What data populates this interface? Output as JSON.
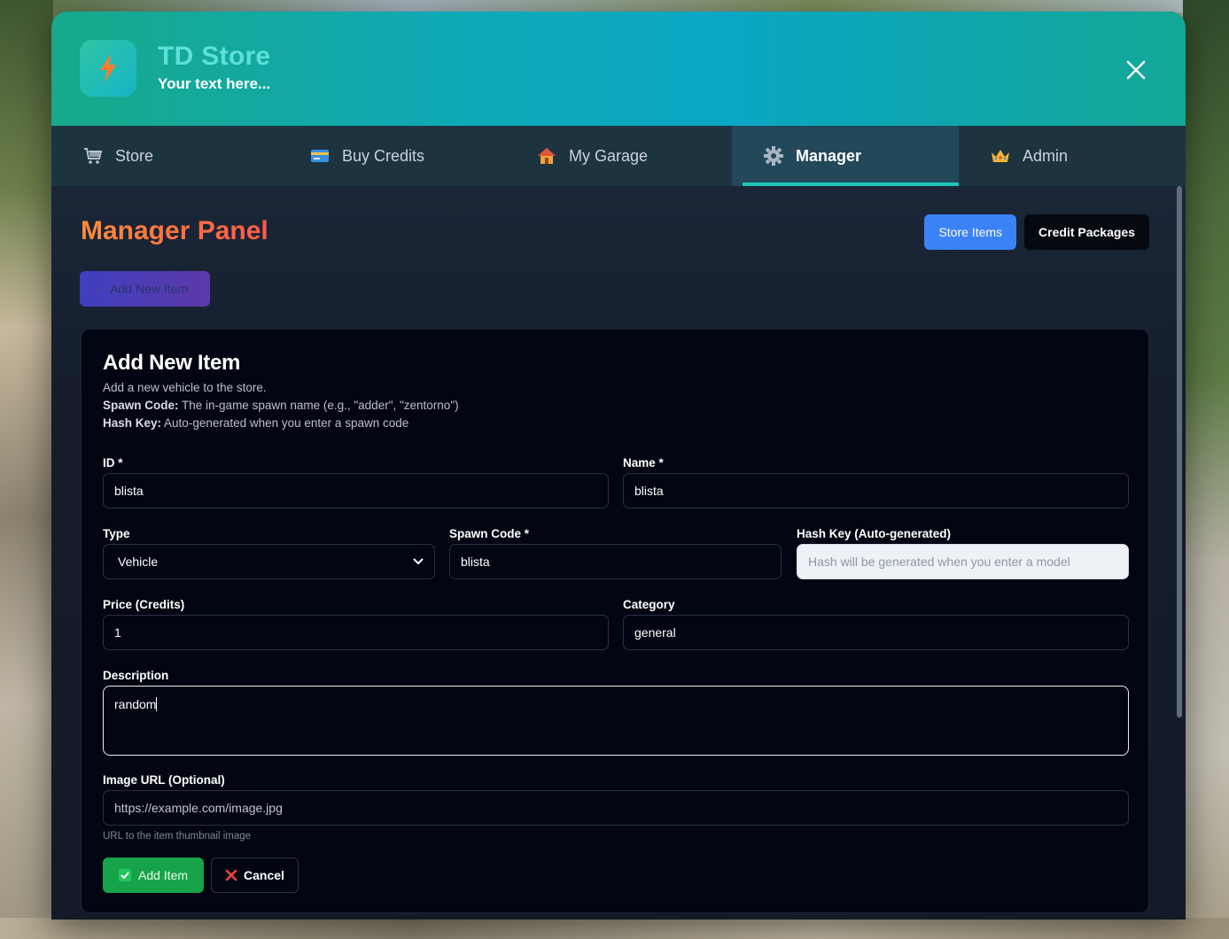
{
  "app": {
    "title": "TD Store",
    "subtitle": "Your text here..."
  },
  "icons": {
    "logo": "lightning-bolt-icon",
    "close": "close-icon",
    "tabs": [
      "cart-icon",
      "credit-card-icon",
      "house-icon",
      "gear-icon",
      "crown-icon"
    ]
  },
  "tabs": [
    {
      "label": "Store",
      "active": false
    },
    {
      "label": "Buy Credits",
      "active": false
    },
    {
      "label": "My Garage",
      "active": false
    },
    {
      "label": "Manager",
      "active": true
    },
    {
      "label": "Admin",
      "active": false
    }
  ],
  "panel": {
    "title": "Manager Panel",
    "segments": [
      "Store Items",
      "Credit Packages"
    ],
    "add_new_label": "Add New Item"
  },
  "form": {
    "title": "Add New Item",
    "description": "Add a new vehicle to the store.",
    "spawn_code_label": "Spawn Code:",
    "spawn_code_help": "The in-game spawn name (e.g., \"adder\", \"zentorno\")",
    "hash_key_label": "Hash Key:",
    "hash_key_help": "Auto-generated when you enter a spawn code",
    "fields": {
      "id": {
        "label": "ID *",
        "value": "blista"
      },
      "name": {
        "label": "Name *",
        "value": "blista"
      },
      "type": {
        "label": "Type",
        "value": "Vehicle"
      },
      "spawn_code": {
        "label": "Spawn Code *",
        "value": "blista"
      },
      "hash_key": {
        "label": "Hash Key (Auto-generated)",
        "placeholder": "Hash will be generated when you enter a model"
      },
      "price": {
        "label": "Price (Credits)",
        "value": "1"
      },
      "category": {
        "label": "Category",
        "value": "general"
      },
      "description": {
        "label": "Description",
        "value": "random"
      },
      "image_url": {
        "label": "Image URL (Optional)",
        "placeholder": "https://example.com/image.jpg",
        "hint": "URL to the item thumbnail image"
      }
    },
    "buttons": {
      "submit": "Add Item",
      "cancel": "Cancel"
    }
  },
  "colors": {
    "accent_teal": "#1ec6b8",
    "title_orange": "#ff6a3d",
    "primary_blue": "#3b82f6",
    "success_green": "#16a34a",
    "cancel_red": "#ef4444"
  }
}
